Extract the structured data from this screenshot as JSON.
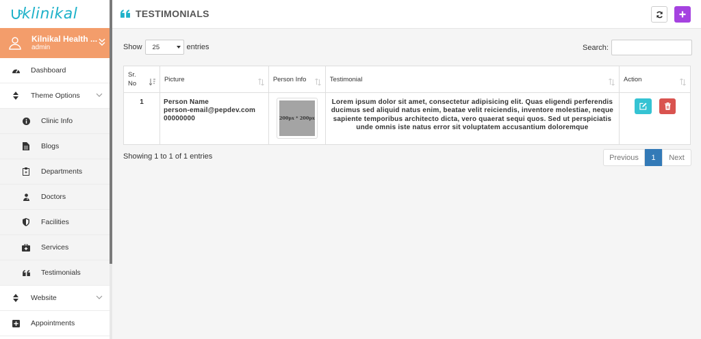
{
  "brand": {
    "name": "klinikal",
    "accent": "#1fb2c9"
  },
  "profile": {
    "name": "Kilnikal Health ...",
    "role": "admin",
    "color": "#f39d6b"
  },
  "sidebar": {
    "items": [
      {
        "label": "Dashboard",
        "icon": "dashboard-icon"
      },
      {
        "label": "Theme Options",
        "icon": "sort-icon",
        "expandable": true
      },
      {
        "label": "Clinic Info",
        "icon": "info-circle-icon",
        "sub": true
      },
      {
        "label": "Blogs",
        "icon": "file-text-icon",
        "sub": true
      },
      {
        "label": "Departments",
        "icon": "clipboard-icon",
        "sub": true
      },
      {
        "label": "Doctors",
        "icon": "user-md-icon",
        "sub": true
      },
      {
        "label": "Facilities",
        "icon": "shield-icon",
        "sub": true
      },
      {
        "label": "Services",
        "icon": "medkit-icon",
        "sub": true
      },
      {
        "label": "Testimonials",
        "icon": "quote-icon",
        "sub": true
      },
      {
        "label": "Website",
        "icon": "sort-icon",
        "expandable": true
      },
      {
        "label": "Appointments",
        "icon": "plus-square-icon"
      }
    ]
  },
  "header": {
    "title": "TESTIMONIALS"
  },
  "controls": {
    "show_label": "Show",
    "page_size": "25",
    "entries_label": "entries",
    "search_label": "Search:",
    "search_value": ""
  },
  "table": {
    "headers": [
      "Sr. No",
      "Picture",
      "Person Info",
      "Testimonial",
      "Action"
    ],
    "rows": [
      {
        "sr": "1",
        "name": "Person Name",
        "email": "person-email@pepdev.com",
        "phone": "00000000",
        "image_placeholder": "200px * 200px",
        "testimonial": "Lorem ipsum dolor sit amet, consectetur adipisicing elit. Quas eligendi perferendis ducimus sed aliquid natus enim, beatae velit reiciendis, inventore molestiae, neque sapiente temporibus architecto dicta, vero quaerat sequi quos. Sed ut perspiciatis unde omnis iste natus error sit voluptatem accusantium doloremque"
      }
    ]
  },
  "footer": {
    "info": "Showing 1 to 1 of 1 entries",
    "prev": "Previous",
    "current_page": "1",
    "next": "Next"
  },
  "colors": {
    "add_button": "#a542e0",
    "edit_button": "#35c3d3",
    "delete_button": "#d9534f",
    "pager_active": "#337ab7"
  }
}
